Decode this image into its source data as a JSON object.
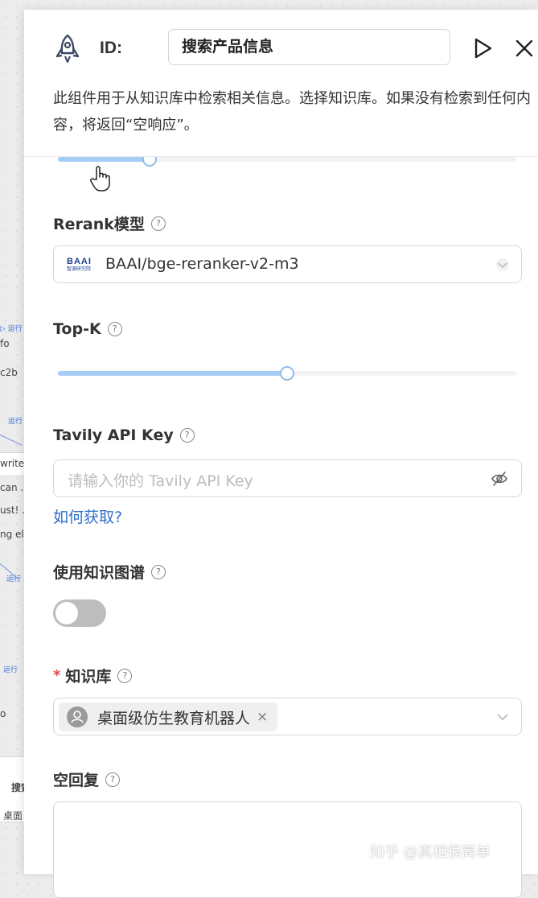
{
  "header": {
    "id_label": "ID:",
    "component_name": "搜索产品信息",
    "description": "此组件用于从知识库中检索相关信息。选择知识库。如果没有检索到任何内容，将返回“空响应”。"
  },
  "icons": {
    "component_icon": "rocket-icon",
    "run": "play-icon",
    "close": "close-icon",
    "help": "question-circle-icon",
    "visibility": "eye-off-icon",
    "dropdown": "chevron-down-icon",
    "cursor": "hand-pointer-icon"
  },
  "similarity_slider": {
    "level": 0.2
  },
  "rerank": {
    "label": "Rerank模型",
    "logo_text": "BAAI",
    "logo_subtext": "智源研究院",
    "value": "BAAI/bge-reranker-v2-m3"
  },
  "top_k": {
    "label": "Top-K",
    "level": 0.5
  },
  "tavily": {
    "label": "Tavily API Key",
    "placeholder": "请输入你的 Tavily API Key",
    "help_link": "如何获取?"
  },
  "knowledge_graph": {
    "label": "使用知识图谱",
    "enabled": false
  },
  "knowledge_base": {
    "label": "知识库",
    "required_mark": "*",
    "selected": [
      "桌面级仿生教育机器人"
    ],
    "remove_glyph": "×"
  },
  "empty_response": {
    "label": "空回复",
    "value": ""
  },
  "help_glyph": "?",
  "watermark": "知乎 @真相很简单",
  "background_canvas": {
    "run_labels": [
      "▷ 运行",
      "运行",
      "运行",
      "运行"
    ],
    "fragments": [
      "fo",
      "c2b",
      "write",
      "can ...",
      "ust! ...",
      "ng el",
      "o",
      "搜索",
      "桌面"
    ]
  },
  "colors": {
    "accent_link": "#2f6fc9",
    "slider_fill": "#a6cdf3",
    "required": "#e5484d",
    "toggle_off": "#bdbdbd"
  }
}
